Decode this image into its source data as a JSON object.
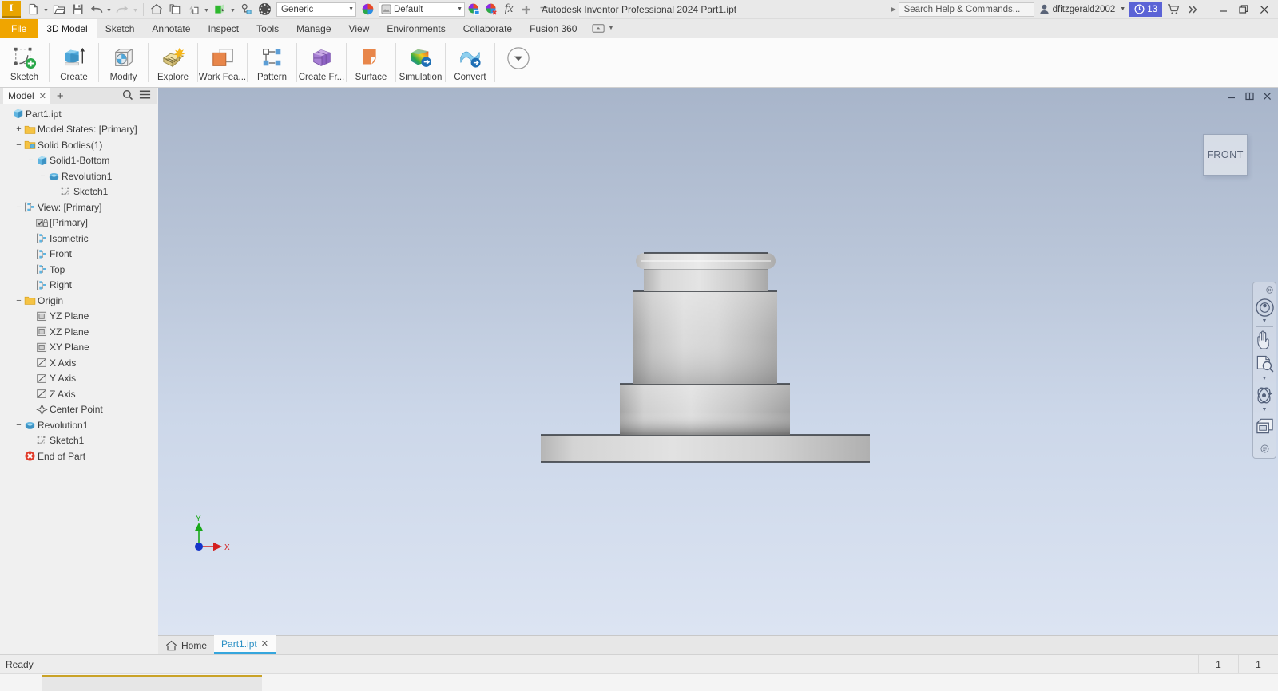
{
  "titlebar": {
    "app_initial": "I",
    "document_title": "Autodesk Inventor Professional 2024   Part1.ipt",
    "material": "Generic",
    "appearance": "Default",
    "search_placeholder": "Search Help & Commands...",
    "username": "dfitzgerald2002",
    "notification_count": "13",
    "qat_items": [
      "new-icon",
      "open-icon",
      "save-icon",
      "undo-icon",
      "redo-icon",
      "home-icon",
      "project-icon",
      "updates-icon",
      "appearance-icon",
      "parameters-icon",
      "material-wheel-icon"
    ],
    "window_controls": [
      "minimize",
      "restore",
      "close"
    ]
  },
  "ribbon_tabs": [
    {
      "label": "File",
      "state": "file"
    },
    {
      "label": "3D Model",
      "state": "active"
    },
    {
      "label": "Sketch",
      "state": "normal"
    },
    {
      "label": "Annotate",
      "state": "normal"
    },
    {
      "label": "Inspect",
      "state": "normal"
    },
    {
      "label": "Tools",
      "state": "normal"
    },
    {
      "label": "Manage",
      "state": "normal"
    },
    {
      "label": "View",
      "state": "normal"
    },
    {
      "label": "Environments",
      "state": "normal"
    },
    {
      "label": "Collaborate",
      "state": "normal"
    },
    {
      "label": "Fusion 360",
      "state": "normal"
    }
  ],
  "ribbon_buttons": [
    {
      "label": "Sketch",
      "icon": "sketch-icon"
    },
    {
      "label": "Create",
      "icon": "create-icon"
    },
    {
      "label": "Modify",
      "icon": "modify-icon"
    },
    {
      "label": "Explore",
      "icon": "explore-icon"
    },
    {
      "label": "Work Fea...",
      "icon": "work-features-icon"
    },
    {
      "label": "Pattern",
      "icon": "pattern-icon"
    },
    {
      "label": "Create Fr...",
      "icon": "create-freeform-icon"
    },
    {
      "label": "Surface",
      "icon": "surface-icon"
    },
    {
      "label": "Simulation",
      "icon": "simulation-icon"
    },
    {
      "label": "Convert",
      "icon": "convert-icon"
    }
  ],
  "browser": {
    "tab_label": "Model",
    "tree": [
      {
        "label": "Part1.ipt",
        "depth": 0,
        "expander": "",
        "icon": "part-icon"
      },
      {
        "label": "Model States: [Primary]",
        "depth": 1,
        "expander": "+",
        "icon": "folder-icon"
      },
      {
        "label": "Solid Bodies(1)",
        "depth": 1,
        "expander": "−",
        "icon": "folder-bodies-icon"
      },
      {
        "label": "Solid1-Bottom",
        "depth": 2,
        "expander": "−",
        "icon": "solid-icon"
      },
      {
        "label": "Revolution1",
        "depth": 3,
        "expander": "−",
        "icon": "revolution-icon"
      },
      {
        "label": "Sketch1",
        "depth": 4,
        "expander": "",
        "icon": "sketch-tree-icon"
      },
      {
        "label": "View: [Primary]",
        "depth": 1,
        "expander": "−",
        "icon": "view-icon"
      },
      {
        "label": "[Primary]",
        "depth": 2,
        "expander": "",
        "icon": "checkbox-lock-icon"
      },
      {
        "label": "Isometric",
        "depth": 2,
        "expander": "",
        "icon": "view-icon"
      },
      {
        "label": "Front",
        "depth": 2,
        "expander": "",
        "icon": "view-icon"
      },
      {
        "label": "Top",
        "depth": 2,
        "expander": "",
        "icon": "view-icon"
      },
      {
        "label": "Right",
        "depth": 2,
        "expander": "",
        "icon": "view-icon"
      },
      {
        "label": "Origin",
        "depth": 1,
        "expander": "−",
        "icon": "folder-icon"
      },
      {
        "label": "YZ Plane",
        "depth": 2,
        "expander": "",
        "icon": "plane-icon"
      },
      {
        "label": "XZ Plane",
        "depth": 2,
        "expander": "",
        "icon": "plane-icon"
      },
      {
        "label": "XY Plane",
        "depth": 2,
        "expander": "",
        "icon": "plane-icon"
      },
      {
        "label": "X Axis",
        "depth": 2,
        "expander": "",
        "icon": "axis-icon"
      },
      {
        "label": "Y Axis",
        "depth": 2,
        "expander": "",
        "icon": "axis-icon"
      },
      {
        "label": "Z Axis",
        "depth": 2,
        "expander": "",
        "icon": "axis-icon"
      },
      {
        "label": "Center Point",
        "depth": 2,
        "expander": "",
        "icon": "center-point-icon"
      },
      {
        "label": "Revolution1",
        "depth": 1,
        "expander": "−",
        "icon": "revolution-icon"
      },
      {
        "label": "Sketch1",
        "depth": 2,
        "expander": "",
        "icon": "sketch-tree-icon"
      },
      {
        "label": "End of Part",
        "depth": 1,
        "expander": "",
        "icon": "end-of-part-icon"
      }
    ]
  },
  "viewport": {
    "viewcube_face": "FRONT",
    "axis_x_label": "X",
    "axis_y_label": "Y",
    "nav_tools": [
      "steering-wheel-icon",
      "pan-icon",
      "zoom-icon",
      "orbit-icon",
      "look-at-icon"
    ],
    "bg_top_color": "#a8b5ca",
    "bg_bottom_color": "#dce4f2",
    "model_color": "#c9c9c9"
  },
  "doctabs": [
    {
      "label": "Home",
      "state": "normal",
      "icon": "home-icon"
    },
    {
      "label": "Part1.ipt",
      "state": "active",
      "icon": ""
    }
  ],
  "statusbar": {
    "message": "Ready",
    "cell_1": "1",
    "cell_2": "1"
  }
}
